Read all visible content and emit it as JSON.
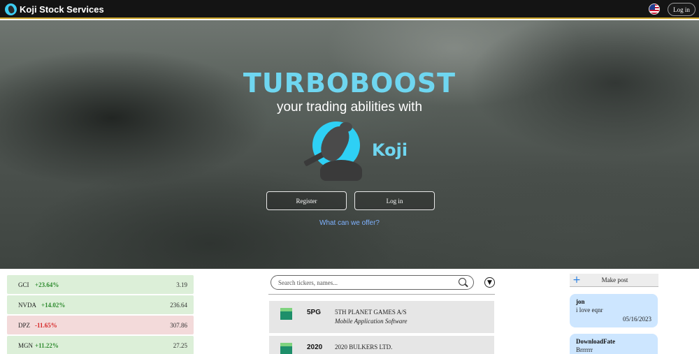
{
  "header": {
    "brand": "Koji Stock Services",
    "login_label": "Log in",
    "language_flag": "us-flag-icon"
  },
  "hero": {
    "title": "TURBOBOOST",
    "subtitle": "your trading abilities with",
    "logo_word": "Koji",
    "register_label": "Register",
    "login_label": "Log in",
    "link_label": "What can we offer?",
    "accent_color": "#6fd6f0"
  },
  "tickers": [
    {
      "symbol": "GCI",
      "change": "+23.64%",
      "price": "3.19",
      "direction": "up"
    },
    {
      "symbol": "NVDA",
      "change": "+14.02%",
      "price": "236.64",
      "direction": "up"
    },
    {
      "symbol": "DPZ",
      "change": "-11.65%",
      "price": "307.86",
      "direction": "down"
    },
    {
      "symbol": "MGN",
      "change": "+11.22%",
      "price": "27.25",
      "direction": "up"
    }
  ],
  "search": {
    "placeholder": "Search tickers, names..."
  },
  "stocks": [
    {
      "symbol": "5PG",
      "name": "5TH PLANET GAMES A/S",
      "sector": "Mobile Application Software"
    },
    {
      "symbol": "2020",
      "name": "2020 BULKERS LTD.",
      "sector": ""
    }
  ],
  "posts_panel": {
    "make_post_label": "Make post",
    "posts": [
      {
        "user": "jon",
        "text": "i love eqnr",
        "date": "05/16/2023"
      },
      {
        "user": "DownloadFate",
        "text": "Brrrrrr",
        "date": ""
      }
    ]
  },
  "colors": {
    "up": "#2e8b2e",
    "down": "#d62828",
    "post_bg": "#cde6ff",
    "topbar_border": "#c9a227"
  }
}
